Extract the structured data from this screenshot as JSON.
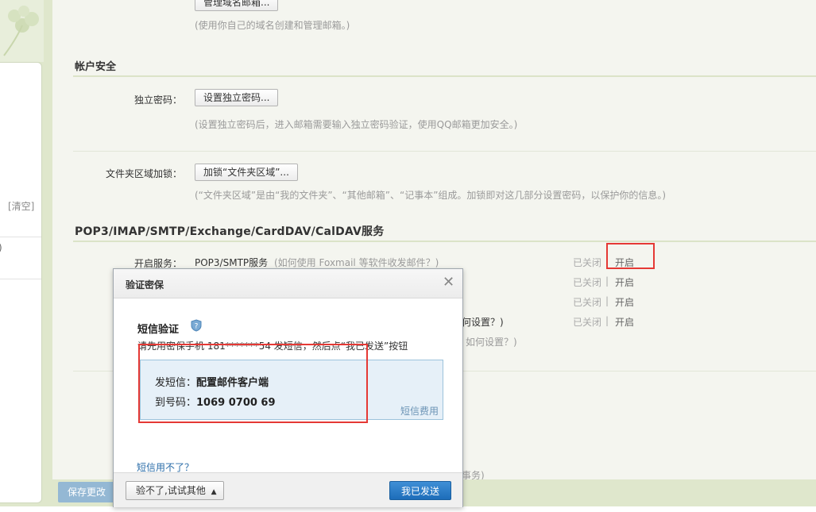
{
  "left_panel": {
    "clear_label": "[清空]",
    "paren": ")"
  },
  "main": {
    "manage_domain_btn": "管理域名邮箱...",
    "domain_hint": "(使用你自己的域名创建和管理邮箱。)",
    "account_security": {
      "title": "帐户安全",
      "independent_password_label": "独立密码：",
      "independent_password_btn": "设置独立密码...",
      "independent_password_hint": "(设置独立密码后，进入邮箱需要输入独立密码验证，使用QQ邮箱更加安全。)",
      "folder_lock_label": "文件夹区域加锁：",
      "folder_lock_btn": "加锁“文件夹区域”...",
      "folder_lock_hint": "(“文件夹区域”是由“我的文件夹”、“其他邮箱”、“记事本”组成。加锁即对这几部分设置密码，以保护你的信息。)"
    },
    "services": {
      "title": "POP3/IMAP/SMTP/Exchange/CardDAV/CalDAV服务",
      "enable_label": "开启服务：",
      "row1_name": "POP3/SMTP服务",
      "row1_help": "(如何使用 Foxmail 等软件收发邮件？)",
      "row4_partial": "何设置？)",
      "row5_partial": "如何设置？)",
      "partial_bottom": "事务)",
      "rows": [
        {
          "status": "已关闭",
          "sep": "|",
          "action": "开启"
        },
        {
          "status": "已关闭",
          "sep": "|",
          "action": "开启"
        },
        {
          "status": "已关闭",
          "sep": "|",
          "action": "开启"
        },
        {
          "status": "已关闭",
          "sep": "|",
          "action": "开启"
        }
      ]
    },
    "save_button": "保存更改"
  },
  "dialog": {
    "title": "验证密保",
    "close": "✕",
    "sms_title": "短信验证",
    "instruction": "请先用密保手机 181*******54 发短信，然后点“我已发送”按钮",
    "send_label": "发短信：",
    "send_content": "配置邮件客户端",
    "to_label": "到号码：",
    "to_number": "1069 0700 69",
    "sms_fee": "短信费用",
    "cant_sms": "短信用不了？",
    "try_other": "验不了,试试其他",
    "sent_button": "我已发送"
  },
  "colors": {
    "accent_blue": "#1d6db9",
    "highlight_red": "#e53935",
    "hint_gray": "#9a9a9a"
  }
}
